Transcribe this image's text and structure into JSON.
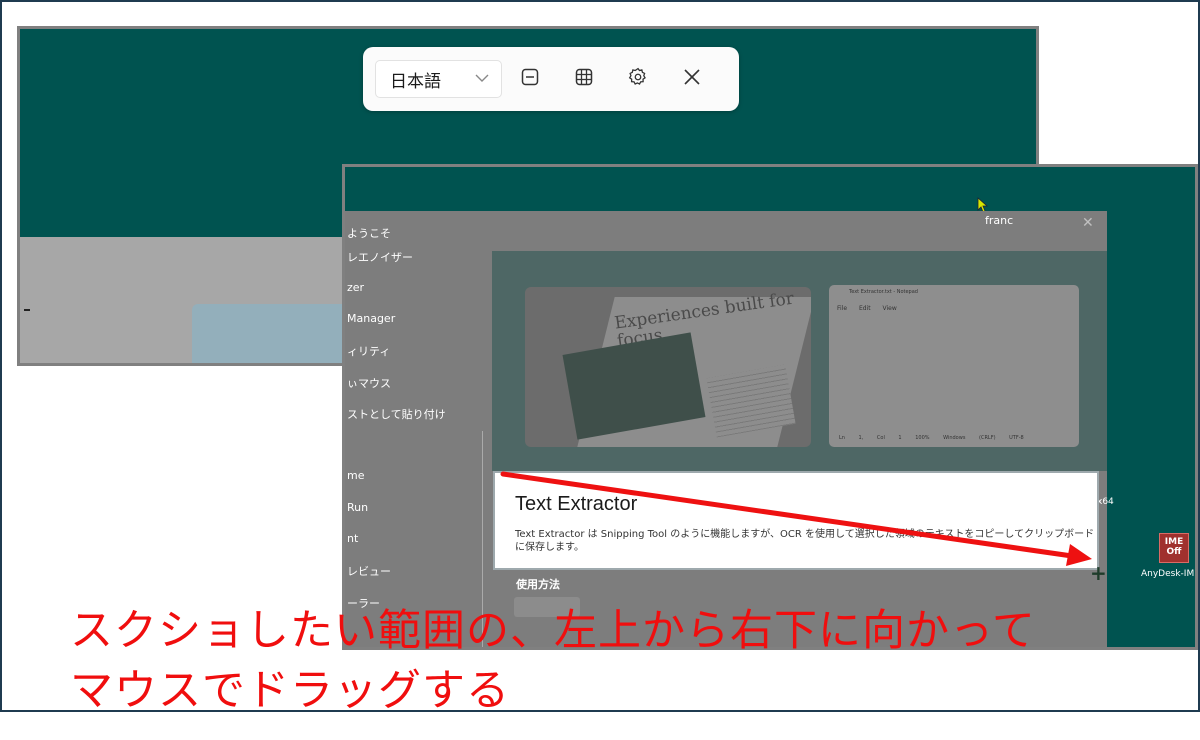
{
  "toolbar": {
    "language": "日本語",
    "icons": [
      "single-line-icon",
      "table-icon",
      "settings-icon",
      "close-icon"
    ]
  },
  "powertoys": {
    "search_value": "franc",
    "nav_items": [
      "ようこそ",
      "レエノイザー",
      "zer",
      "Manager",
      "ィリティ",
      "ぃマウス",
      "ストとして貼り付け",
      "me",
      "Run",
      "nt",
      "レビュー",
      "ーラー"
    ],
    "hero": {
      "magazine_title": "Experiences built for focus",
      "notepad_title": "Text Extractor.txt - Notepad",
      "notepad_menu": [
        "File",
        "Edit",
        "View"
      ],
      "notepad_status": [
        "Ln 1, Col 1",
        "100%",
        "Windows (CRLF)",
        "UTF-8"
      ]
    },
    "module": {
      "title": "Text Extractor",
      "description": "Text Extractor は Snipping Tool のように機能しますが、OCR を使用して選択した領域のテキストをコピーしてクリップボードに保存します。"
    },
    "usage_label": "使用方法"
  },
  "desktop": {
    "x64_label": "x64",
    "anydesk_icon_text": "IME Off",
    "anydesk_label": "AnyDesk-IME"
  },
  "caption": {
    "line1": "スクショしたい範囲の、左上から右下に向かって",
    "line2": "マウスでドラッグする"
  },
  "colors": {
    "teal": "#005350",
    "arrow_red": "#ee1111",
    "caption_red": "#f00e0e",
    "frame": "#1f3b50"
  }
}
